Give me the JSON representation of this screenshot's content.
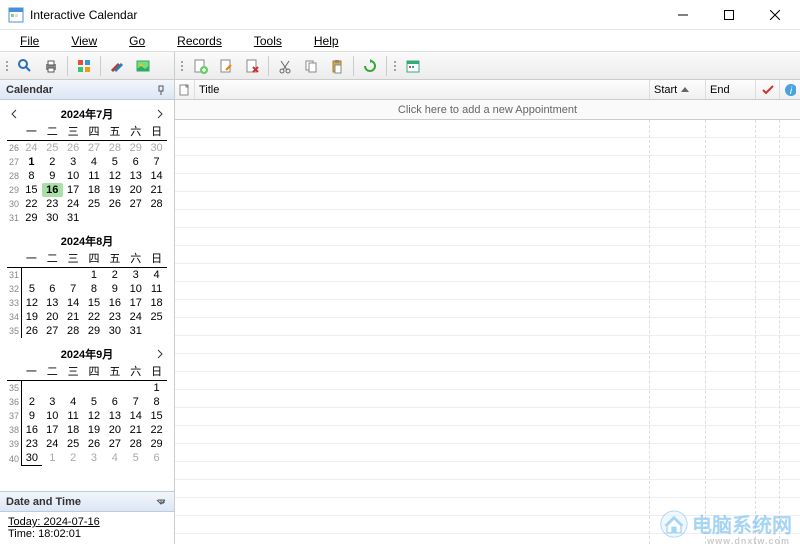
{
  "window": {
    "title": "Interactive Calendar"
  },
  "menu": {
    "file": "File",
    "view": "View",
    "go": "Go",
    "records": "Records",
    "tools": "Tools",
    "help": "Help"
  },
  "sidebar": {
    "header": "Calendar",
    "dt_header": "Date and Time",
    "today_label": "Today: 2024-07-16",
    "time_label": "Time: 18:02:01"
  },
  "months": [
    {
      "title": "2024年7月",
      "showNav": true,
      "dow": [
        "一",
        "二",
        "三",
        "四",
        "五",
        "六",
        "日"
      ],
      "weeks": [
        {
          "wk": "26",
          "days": [
            {
              "d": 24,
              "out": true
            },
            {
              "d": 25,
              "out": true
            },
            {
              "d": 26,
              "out": true
            },
            {
              "d": 27,
              "out": true
            },
            {
              "d": 28,
              "out": true
            },
            {
              "d": 29,
              "out": true
            },
            {
              "d": 30,
              "out": true
            }
          ]
        },
        {
          "wk": "27",
          "days": [
            {
              "d": 1,
              "bold": true
            },
            {
              "d": 2
            },
            {
              "d": 3
            },
            {
              "d": 4
            },
            {
              "d": 5
            },
            {
              "d": 6
            },
            {
              "d": 7
            }
          ]
        },
        {
          "wk": "28",
          "days": [
            {
              "d": 8
            },
            {
              "d": 9
            },
            {
              "d": 10
            },
            {
              "d": 11
            },
            {
              "d": 12
            },
            {
              "d": 13
            },
            {
              "d": 14
            }
          ]
        },
        {
          "wk": "29",
          "days": [
            {
              "d": 15
            },
            {
              "d": 16,
              "today": true
            },
            {
              "d": 17
            },
            {
              "d": 18
            },
            {
              "d": 19
            },
            {
              "d": 20
            },
            {
              "d": 21
            }
          ]
        },
        {
          "wk": "30",
          "days": [
            {
              "d": 22
            },
            {
              "d": 23
            },
            {
              "d": 24
            },
            {
              "d": 25
            },
            {
              "d": 26
            },
            {
              "d": 27
            },
            {
              "d": 28
            }
          ]
        },
        {
          "wk": "31",
          "days": [
            {
              "d": 29
            },
            {
              "d": 30
            },
            {
              "d": 31
            },
            {
              "d": "",
              "out": true
            },
            {
              "d": "",
              "out": true
            },
            {
              "d": "",
              "out": true
            },
            {
              "d": "",
              "out": true
            }
          ]
        }
      ]
    },
    {
      "title": "2024年8月",
      "showNav": false,
      "dow": [
        "一",
        "二",
        "三",
        "四",
        "五",
        "六",
        "日"
      ],
      "weeks": [
        {
          "wk": "31",
          "days": [
            {
              "d": "",
              "out": true,
              "bl": true
            },
            {
              "d": "",
              "out": true
            },
            {
              "d": "",
              "out": true
            },
            {
              "d": 1
            },
            {
              "d": 2
            },
            {
              "d": 3
            },
            {
              "d": 4
            }
          ]
        },
        {
          "wk": "32",
          "days": [
            {
              "d": 5,
              "bl": true
            },
            {
              "d": 6
            },
            {
              "d": 7
            },
            {
              "d": 8
            },
            {
              "d": 9
            },
            {
              "d": 10
            },
            {
              "d": 11
            }
          ]
        },
        {
          "wk": "33",
          "days": [
            {
              "d": 12,
              "bl": true
            },
            {
              "d": 13
            },
            {
              "d": 14
            },
            {
              "d": 15
            },
            {
              "d": 16
            },
            {
              "d": 17
            },
            {
              "d": 18
            }
          ]
        },
        {
          "wk": "34",
          "days": [
            {
              "d": 19,
              "bl": true
            },
            {
              "d": 20
            },
            {
              "d": 21
            },
            {
              "d": 22
            },
            {
              "d": 23
            },
            {
              "d": 24
            },
            {
              "d": 25
            }
          ]
        },
        {
          "wk": "35",
          "days": [
            {
              "d": 26,
              "bl": true
            },
            {
              "d": 27
            },
            {
              "d": 28
            },
            {
              "d": 29
            },
            {
              "d": 30
            },
            {
              "d": 31
            },
            {
              "d": "",
              "out": true
            }
          ]
        }
      ]
    },
    {
      "title": "2024年9月",
      "showNav": true,
      "navRightOnly": true,
      "dow": [
        "一",
        "二",
        "三",
        "四",
        "五",
        "六",
        "日"
      ],
      "weeks": [
        {
          "wk": "35",
          "days": [
            {
              "d": "",
              "out": true,
              "bl": true
            },
            {
              "d": "",
              "out": true
            },
            {
              "d": "",
              "out": true
            },
            {
              "d": "",
              "out": true
            },
            {
              "d": "",
              "out": true
            },
            {
              "d": "",
              "out": true
            },
            {
              "d": 1
            }
          ]
        },
        {
          "wk": "36",
          "days": [
            {
              "d": 2,
              "bl": true
            },
            {
              "d": 3
            },
            {
              "d": 4
            },
            {
              "d": 5
            },
            {
              "d": 6
            },
            {
              "d": 7
            },
            {
              "d": 8
            }
          ]
        },
        {
          "wk": "37",
          "days": [
            {
              "d": 9,
              "bl": true
            },
            {
              "d": 10
            },
            {
              "d": 11
            },
            {
              "d": 12
            },
            {
              "d": 13
            },
            {
              "d": 14
            },
            {
              "d": 15
            }
          ]
        },
        {
          "wk": "38",
          "days": [
            {
              "d": 16,
              "bl": true
            },
            {
              "d": 17
            },
            {
              "d": 18
            },
            {
              "d": 19
            },
            {
              "d": 20
            },
            {
              "d": 21
            },
            {
              "d": 22
            }
          ]
        },
        {
          "wk": "39",
          "days": [
            {
              "d": 23,
              "bl": true
            },
            {
              "d": 24
            },
            {
              "d": 25
            },
            {
              "d": 26
            },
            {
              "d": 27
            },
            {
              "d": 28
            },
            {
              "d": 29
            }
          ]
        },
        {
          "wk": "40",
          "days": [
            {
              "d": 30,
              "bb": true,
              "bl": true
            },
            {
              "d": 1,
              "out": true
            },
            {
              "d": 2,
              "out": true
            },
            {
              "d": 3,
              "out": true
            },
            {
              "d": 4,
              "out": true
            },
            {
              "d": 5,
              "out": true
            },
            {
              "d": 6,
              "out": true
            }
          ]
        }
      ]
    }
  ],
  "columns": {
    "title": "Title",
    "start": "Start",
    "end": "End"
  },
  "grid": {
    "add_hint": "Click here to add a new Appointment"
  },
  "watermark": {
    "text": "电脑系统网",
    "sub": "www.dnxtw.com"
  }
}
